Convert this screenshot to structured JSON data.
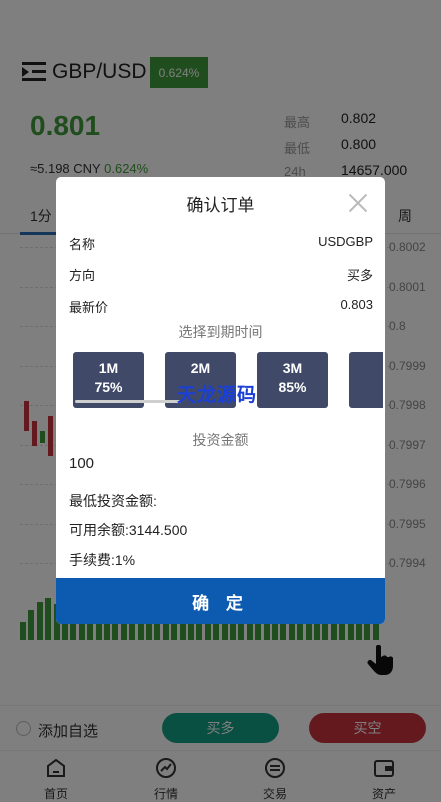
{
  "header": {
    "pair": "GBP/USD",
    "change_badge": "0.624%"
  },
  "quote": {
    "price": "0.801",
    "cny_prefix": "≈5.198 CNY",
    "cny_change": "0.624%",
    "stats": [
      {
        "label": "最高",
        "value": "0.802"
      },
      {
        "label": "最低",
        "value": "0.800"
      },
      {
        "label": "24h",
        "value": "14657.000"
      }
    ]
  },
  "chart_tabs": [
    "1分",
    "周"
  ],
  "y_axis_ticks": [
    "0.8002",
    "0.8001",
    "0.8",
    "0.7999",
    "0.7998",
    "0.7997",
    "0.7996",
    "0.7995",
    "0.7994"
  ],
  "modal": {
    "title": "确认订单",
    "rows": [
      {
        "label": "名称",
        "value": "USDGBP"
      },
      {
        "label": "方向",
        "value": "买多"
      },
      {
        "label": "最新价",
        "value": "0.803"
      }
    ],
    "expiry_label": "选择到期时间",
    "periods": [
      {
        "time": "1M",
        "rate": "75%"
      },
      {
        "time": "2M",
        "rate": ""
      },
      {
        "time": "3M",
        "rate": "85%"
      },
      {
        "time": "",
        "rate": ""
      }
    ],
    "watermark": "天龙源码",
    "invest_label": "投资金额",
    "amount": "100",
    "min_invest": "最低投资金额:",
    "available": "可用余额:3144.500",
    "fee": "手续费:1%",
    "confirm": "确 定"
  },
  "actions": {
    "favorite": "添加自选",
    "buy_up": "买多",
    "buy_down": "买空"
  },
  "nav": [
    {
      "label": "首页",
      "icon": "home-icon"
    },
    {
      "label": "行情",
      "icon": "market-icon"
    },
    {
      "label": "交易",
      "icon": "exchange-icon"
    },
    {
      "label": "资产",
      "icon": "wallet-icon"
    }
  ],
  "colors": {
    "up_green": "#3f9b3a",
    "down_red": "#c8323c",
    "confirm_blue": "#0d5bb0",
    "period_bg": "#404a68"
  }
}
